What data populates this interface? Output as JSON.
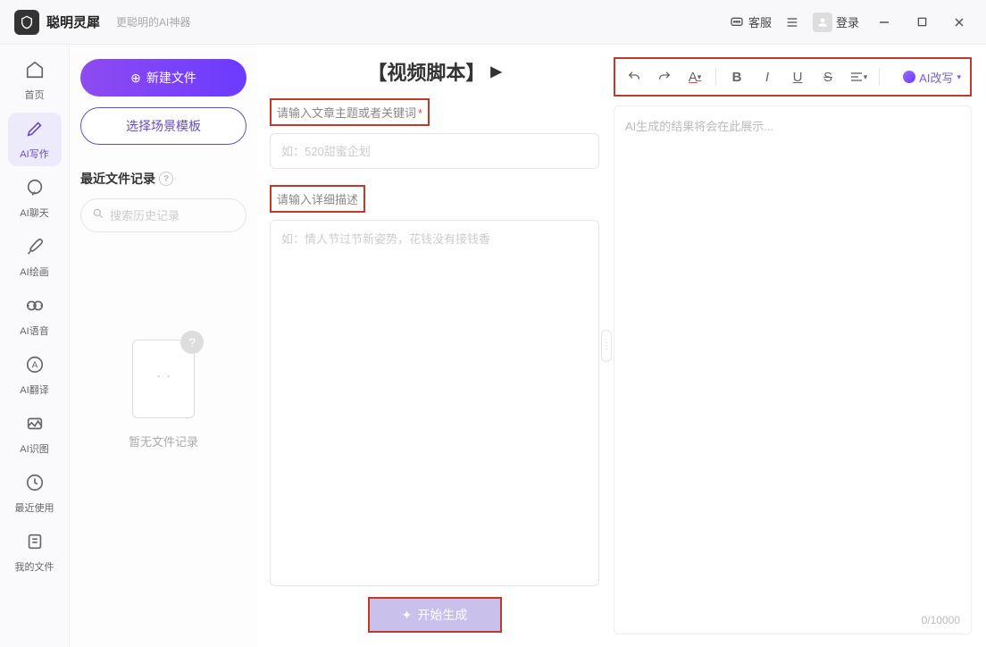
{
  "app": {
    "name": "聪明灵犀",
    "tagline": "更聪明的AI神器"
  },
  "titlebar": {
    "support": "客服",
    "login": "登录"
  },
  "nav": [
    {
      "label": "首页",
      "icon": "home"
    },
    {
      "label": "AI写作",
      "icon": "pen",
      "active": true
    },
    {
      "label": "AI聊天",
      "icon": "chat"
    },
    {
      "label": "AI绘画",
      "icon": "brush"
    },
    {
      "label": "AI语音",
      "icon": "audio"
    },
    {
      "label": "AI翻译",
      "icon": "translate"
    },
    {
      "label": "AI识图",
      "icon": "image"
    },
    {
      "label": "最近使用",
      "icon": "recent"
    },
    {
      "label": "我的文件",
      "icon": "files"
    }
  ],
  "filepane": {
    "new_file": "新建文件",
    "template": "选择场景模板",
    "recent_title": "最近文件记录",
    "search_placeholder": "搜索历史记录",
    "empty": "暂无文件记录"
  },
  "center": {
    "heading": "【视频脚本】",
    "label_topic": "请输入文章主题或者关键词",
    "topic_placeholder": "如：520甜蜜企划",
    "label_desc": "请输入详细描述",
    "desc_placeholder": "如：情人节过节新姿势，花钱没有接钱香",
    "generate": "开始生成"
  },
  "output": {
    "placeholder": "AI生成的结果将会在此展示...",
    "ai_rewrite": "AI改写",
    "count": "0/10000"
  }
}
